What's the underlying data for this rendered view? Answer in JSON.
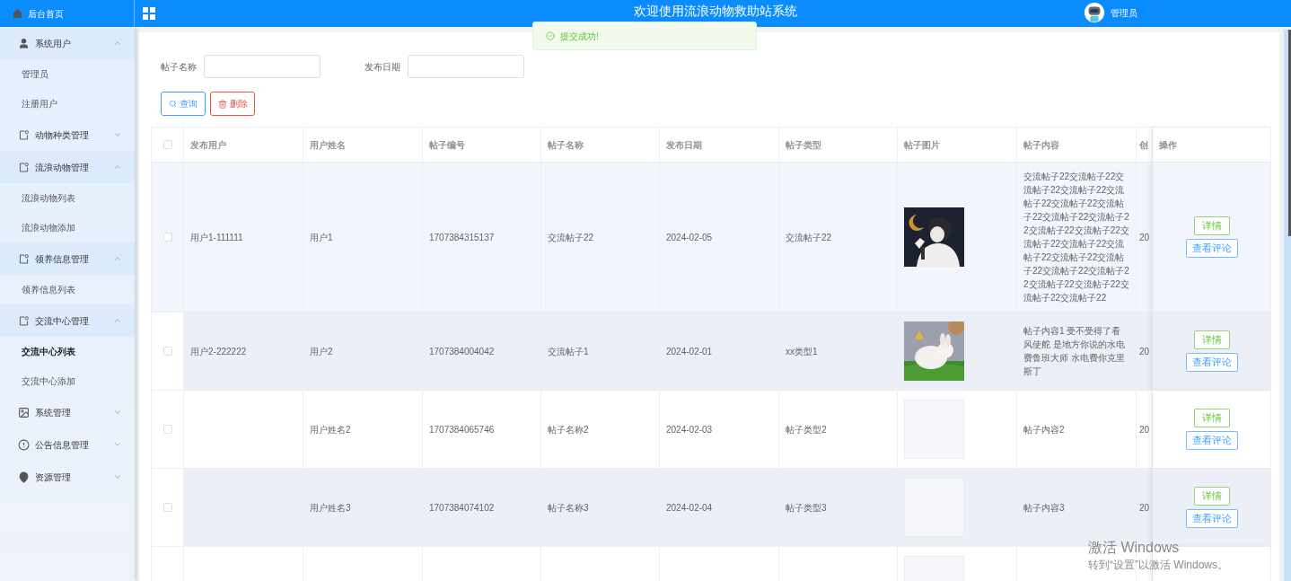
{
  "header": {
    "home_label": "后台首页",
    "title": "欢迎使用流浪动物救助站系统",
    "user_name": "管理员"
  },
  "toast": {
    "kind": "success",
    "message": "提交成功!"
  },
  "sidebar": {
    "groups": [
      {
        "label": "系统用户",
        "expanded": true,
        "children": [
          {
            "label": "管理员",
            "selected": false
          },
          {
            "label": "注册用户",
            "selected": false
          }
        ]
      },
      {
        "label": "动物种类管理",
        "expanded": false
      },
      {
        "label": "流浪动物管理",
        "expanded": true,
        "children": [
          {
            "label": "流浪动物列表",
            "selected": false
          },
          {
            "label": "流浪动物添加",
            "selected": false
          }
        ]
      },
      {
        "label": "领养信息管理",
        "expanded": true,
        "children": [
          {
            "label": "领养信息列表",
            "selected": false
          }
        ]
      },
      {
        "label": "交流中心管理",
        "expanded": true,
        "children": [
          {
            "label": "交流中心列表",
            "selected": true
          },
          {
            "label": "交流中心添加",
            "selected": false
          }
        ]
      },
      {
        "label": "系统管理",
        "expanded": false
      },
      {
        "label": "公告信息管理",
        "expanded": false
      },
      {
        "label": "资源管理",
        "expanded": false
      }
    ]
  },
  "filters": [
    {
      "label": "帖子名称"
    },
    {
      "label": "发布日期"
    }
  ],
  "buttons": [
    {
      "kind": "search",
      "label": "查询"
    },
    {
      "kind": "delete",
      "label": "删除"
    }
  ],
  "table": {
    "header_checked": false,
    "columns": [
      "发布用户",
      "用户姓名",
      "帖子编号",
      "帖子名称",
      "发布日期",
      "帖子类型",
      "帖子图片",
      "帖子内容",
      "创",
      "操作"
    ],
    "rows": [
      {
        "checked": false,
        "hovered": true,
        "publisher": "用户1-111111",
        "user_name": "用户1",
        "post_no": "1707384315137",
        "post_name": "交流帖子22",
        "date": "2024-02-05",
        "post_type": "交流帖子22",
        "content": "交流帖子22交流帖子22交流帖子22交流帖子22交流帖子22交流帖子22交流帖子22交流帖子22交流帖子22交流帖子22交流帖子22交流帖子22交流帖子22交流帖子22交流帖子22交流帖子22交流帖子22交流帖子22交流帖子22交流帖子22交流帖子22交流帖子22",
        "column_9": "20",
        "actions": [
          "详情",
          "查看评论"
        ]
      },
      {
        "checked": false,
        "hovered": false,
        "publisher": "用户2-222222",
        "user_name": "用户2",
        "post_no": "1707384004042",
        "post_name": "交流帖子1",
        "date": "2024-02-01",
        "post_type": "xx类型1",
        "content": "帖子内容1 受不受得了看风使舵 是地方你说的水电费鲁班大师 水电费你克里斯丁",
        "column_9": "20",
        "actions": [
          "详情",
          "查看评论"
        ]
      },
      {
        "checked": false,
        "hovered": false,
        "user_name": "用户姓名2",
        "post_no": "1707384065746",
        "post_name": "帖子名称2",
        "date": "2024-02-03",
        "post_type": "帖子类型2",
        "image": {
          "kind": "empty"
        },
        "content": "帖子内容2",
        "column_9": "20",
        "actions": [
          "详情",
          "查看评论"
        ]
      },
      {
        "checked": false,
        "hovered": false,
        "user_name": "用户姓名3",
        "post_no": "1707384074102",
        "post_name": "帖子名称3",
        "date": "2024-02-04",
        "post_type": "帖子类型3",
        "image": {
          "kind": "empty"
        },
        "content": "帖子内容3",
        "column_9": "20",
        "actions": [
          "详情",
          "查看评论"
        ]
      },
      {
        "image": {
          "kind": "empty"
        }
      }
    ]
  },
  "os_overlay": {
    "title": "激活 Windows",
    "subtitle": "转到“设置”以激活 Windows。"
  }
}
